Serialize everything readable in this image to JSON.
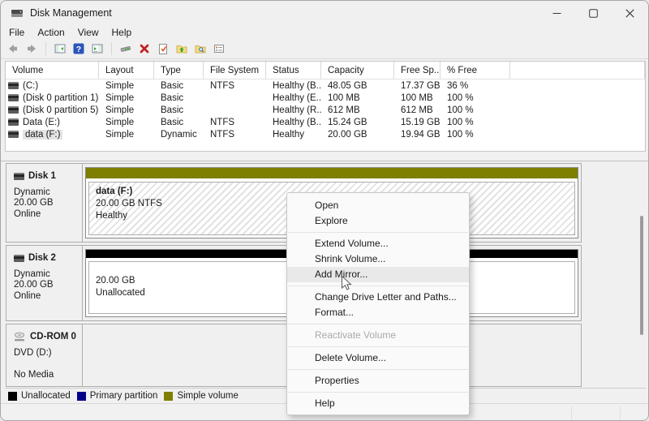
{
  "window": {
    "title": "Disk Management",
    "controls": [
      "minimize-icon",
      "maximize-icon",
      "close-icon"
    ]
  },
  "menubar": {
    "items": [
      "File",
      "Action",
      "View",
      "Help"
    ]
  },
  "toolbar": {
    "icons": [
      "back-icon",
      "forward-icon",
      "console-tree-icon",
      "help-icon",
      "action-pane-icon",
      "device-wand-icon",
      "delete-x-icon",
      "document-check-icon",
      "folder-up-icon",
      "folder-search-icon",
      "details-list-icon"
    ],
    "help_glyph": "?"
  },
  "volume_table": {
    "columns": [
      "Volume",
      "Layout",
      "Type",
      "File System",
      "Status",
      "Capacity",
      "Free Sp...",
      "% Free"
    ],
    "rows": [
      {
        "volume": "(C:)",
        "layout": "Simple",
        "type": "Basic",
        "fs": "NTFS",
        "status": "Healthy (B...",
        "capacity": "48.05 GB",
        "free": "17.37 GB",
        "pct": "36 %"
      },
      {
        "volume": "(Disk 0 partition 1)",
        "layout": "Simple",
        "type": "Basic",
        "fs": "",
        "status": "Healthy (E...",
        "capacity": "100 MB",
        "free": "100 MB",
        "pct": "100 %"
      },
      {
        "volume": "(Disk 0 partition 5)",
        "layout": "Simple",
        "type": "Basic",
        "fs": "",
        "status": "Healthy (R...",
        "capacity": "612 MB",
        "free": "612 MB",
        "pct": "100 %"
      },
      {
        "volume": "Data (E:)",
        "layout": "Simple",
        "type": "Basic",
        "fs": "NTFS",
        "status": "Healthy (B...",
        "capacity": "15.24 GB",
        "free": "15.19 GB",
        "pct": "100 %"
      },
      {
        "volume": "data (F:)",
        "layout": "Simple",
        "type": "Dynamic",
        "fs": "NTFS",
        "status": "Healthy",
        "capacity": "20.00 GB",
        "free": "19.94 GB",
        "pct": "100 %",
        "selected": true
      }
    ]
  },
  "disks": [
    {
      "name": "Disk 1",
      "lines": [
        "Dynamic",
        "20.00 GB",
        "Online"
      ],
      "band_color": "#7e7e00",
      "volume": {
        "title": "data  (F:)",
        "size_fs": "20.00 GB NTFS",
        "status": "Healthy"
      }
    },
    {
      "name": "Disk 2",
      "lines": [
        "Dynamic",
        "20.00 GB",
        "Online"
      ],
      "band_color": "#000000",
      "volume": {
        "size": "20.00 GB",
        "status": "Unallocated"
      }
    },
    {
      "name": "CD-ROM 0",
      "lines": [
        "DVD (D:)",
        "",
        "No Media"
      ]
    }
  ],
  "context_menu": {
    "groups": [
      [
        "Open",
        "Explore"
      ],
      [
        "Extend Volume...",
        "Shrink Volume...",
        "Add Mirror..."
      ],
      [
        "Change Drive Letter and Paths...",
        "Format..."
      ],
      [
        "Reactivate Volume"
      ],
      [
        "Delete Volume..."
      ],
      [
        "Properties"
      ],
      [
        "Help"
      ]
    ],
    "highlighted_item": "Add Mirror...",
    "disabled_item": "Reactivate Volume"
  },
  "legend": [
    {
      "label": "Unallocated",
      "color": "#000000"
    },
    {
      "label": "Primary partition",
      "color": "#00008b"
    },
    {
      "label": "Simple volume",
      "color": "#7e7e00"
    }
  ]
}
